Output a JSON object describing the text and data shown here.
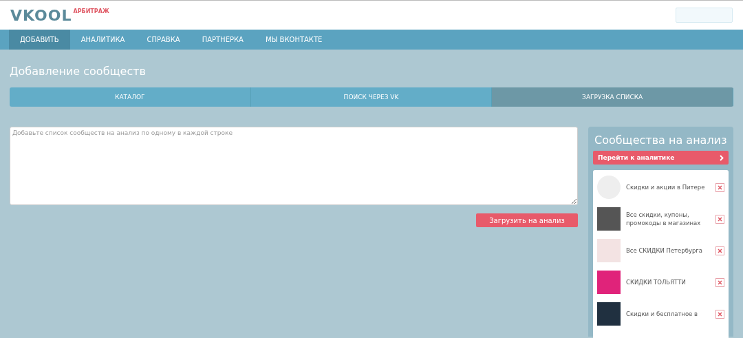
{
  "logo": {
    "name": "VKOOL",
    "tag": "АРБИТРАЖ"
  },
  "nav": [
    {
      "label": "ДОБАВИТЬ",
      "selected": true
    },
    {
      "label": "АНАЛИТИКА",
      "selected": false
    },
    {
      "label": "СПРАВКА",
      "selected": false
    },
    {
      "label": "ПАРТНЕРКА",
      "selected": false
    },
    {
      "label": "МЫ ВКОНТАКТЕ",
      "selected": false
    }
  ],
  "page_title": "Добавление сообществ",
  "tabs": [
    {
      "label": "КАТАЛОГ",
      "selected": false
    },
    {
      "label": "ПОИСК ЧЕРЕЗ VK",
      "selected": false
    },
    {
      "label": "ЗАГРУЗКА СПИСКА",
      "selected": true
    }
  ],
  "list_field": {
    "placeholder": "Добавьте список сообществ на анализ по одному в каждой строке"
  },
  "submit_button": "Загрузить на анализ",
  "sidebar": {
    "title": "Сообщества на анализ",
    "action": "Перейти к аналитике",
    "items": [
      {
        "name": "Скидки и акции в Питере"
      },
      {
        "name": "Все скидки, купоны, промокоды в магазинах"
      },
      {
        "name": "Все СКИДКИ Петербурга"
      },
      {
        "name": "СКИДКИ ТОЛЬЯТТИ"
      },
      {
        "name": "Скидки и бесплатное в"
      }
    ]
  }
}
